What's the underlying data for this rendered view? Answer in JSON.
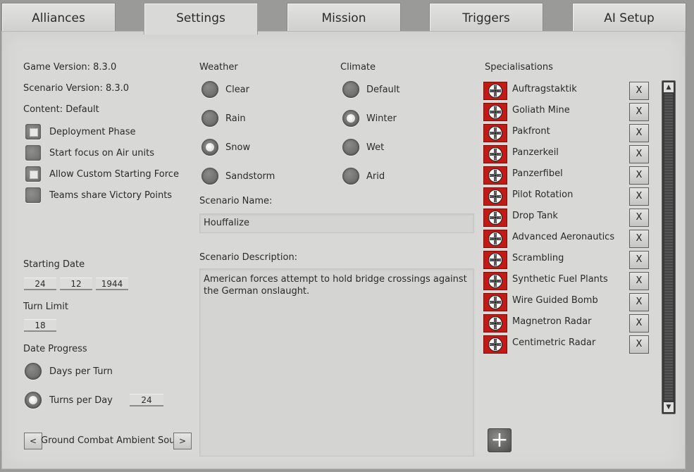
{
  "tabs": [
    "Alliances",
    "Settings",
    "Mission",
    "Triggers",
    "AI Setup"
  ],
  "active_tab": "Settings",
  "info": {
    "game_version": "Game Version: 8.3.0",
    "scenario_version": "Scenario Version: 8.3.0",
    "content": "Content: Default"
  },
  "options": [
    {
      "label": "Deployment Phase",
      "checked": true
    },
    {
      "label": "Start focus on Air units",
      "checked": false
    },
    {
      "label": "Allow Custom Starting Force",
      "checked": true
    },
    {
      "label": "Teams share Victory Points",
      "checked": false
    }
  ],
  "starting_date": {
    "label": "Starting Date",
    "day": "24",
    "month": "12",
    "year": "1944"
  },
  "turn_limit": {
    "label": "Turn Limit",
    "value": "18"
  },
  "date_progress": {
    "label": "Date Progress",
    "days_per_turn": "Days per Turn",
    "turns_per_day": "Turns per Day",
    "turns_value": "24",
    "selected": "turns_per_day"
  },
  "ambient": {
    "label": "Ground Combat Ambient Sound",
    "prev": "<",
    "next": ">"
  },
  "weather": {
    "title": "Weather",
    "options": [
      "Clear",
      "Rain",
      "Snow",
      "Sandstorm"
    ],
    "selected": "Snow"
  },
  "climate": {
    "title": "Climate",
    "options": [
      "Default",
      "Winter",
      "Wet",
      "Arid"
    ],
    "selected": "Winter"
  },
  "scenario_name": {
    "label": "Scenario Name:",
    "value": "Houffalize"
  },
  "scenario_description": {
    "label": "Scenario Description:",
    "value": "American forces attempt to hold bridge crossings against the German onslaught."
  },
  "specialisations": {
    "title": "Specialisations",
    "remove_label": "X",
    "items": [
      "Auftragstaktik",
      "Goliath Mine",
      "Pakfront",
      "Panzerkeil",
      "Panzerfibel",
      "Pilot Rotation",
      "Drop Tank",
      "Advanced Aeronautics",
      "Scrambling",
      "Synthetic Fuel Plants",
      "Wire Guided Bomb",
      "Magnetron Radar",
      "Centimetric Radar"
    ],
    "add_label": "+",
    "flag_color": "#c21a14"
  },
  "scroll": {
    "up": "▲",
    "down": "▼"
  }
}
